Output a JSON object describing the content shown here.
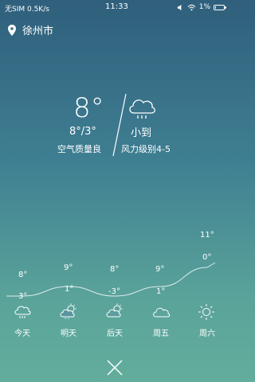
{
  "status_bar": {
    "carrier": "无SIM 0.5K/s",
    "time": "11:33",
    "battery": "1%"
  },
  "location": {
    "city": "徐州市"
  },
  "current": {
    "temperature": "8°",
    "range": "8°/3°",
    "air_quality": "空气质量良",
    "condition": "小到",
    "wind": "风力级别4-5"
  },
  "chart_data": {
    "type": "line",
    "categories": [
      "今天",
      "明天",
      "后天",
      "周五",
      "周六"
    ],
    "series": [
      {
        "values": [
          8,
          9,
          8,
          9,
          11
        ]
      },
      {
        "values": [
          3,
          1,
          -3,
          1,
          0
        ]
      }
    ]
  },
  "forecast": [
    {
      "day": "今天",
      "high": "8°",
      "low": "3°",
      "icon": "rain-cloud-icon"
    },
    {
      "day": "明天",
      "high": "9°",
      "low": "1°",
      "icon": "sun-cloud-icon"
    },
    {
      "day": "后天",
      "high": "8°",
      "low": "-3°",
      "icon": "sun-cloud-icon"
    },
    {
      "day": "周五",
      "high": "9°",
      "low": "1°",
      "icon": "cloud-icon"
    },
    {
      "day": "周六",
      "high": "11°",
      "low": "0°",
      "icon": "sun-icon"
    }
  ]
}
